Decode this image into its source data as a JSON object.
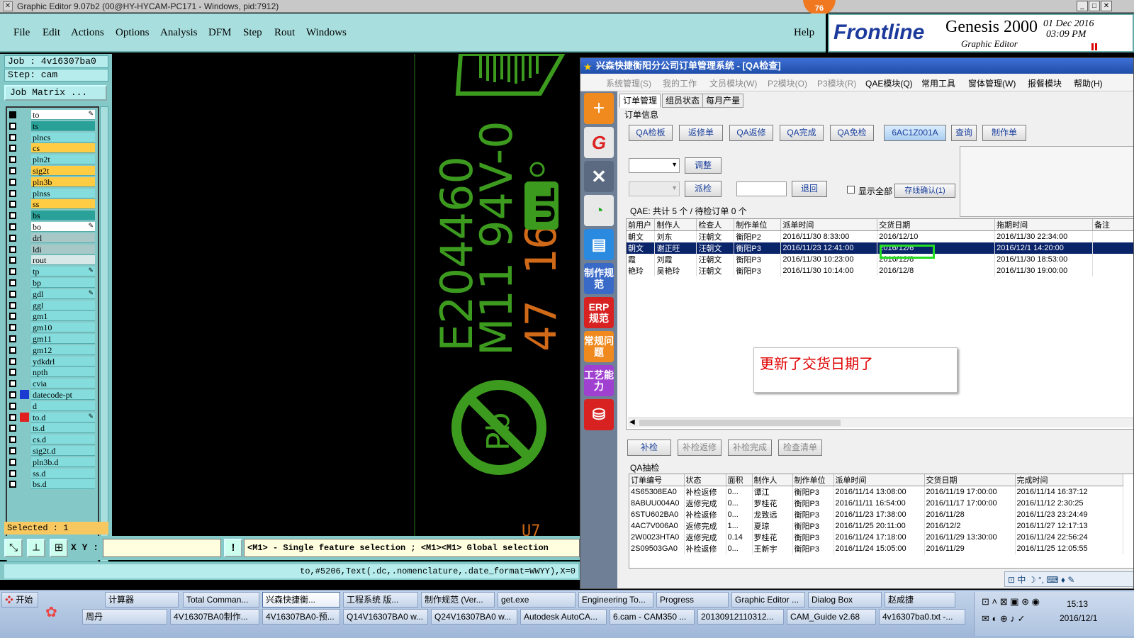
{
  "titlebar": {
    "text": "Graphic Editor 9.07b2 (00@HY-HYCAM-PC171 - Windows, pid:7912)",
    "badge": "76"
  },
  "menu": [
    "File",
    "Edit",
    "Actions",
    "Options",
    "Analysis",
    "DFM",
    "Step",
    "Rout",
    "Windows"
  ],
  "help": "Help",
  "brand": {
    "logo": "Frontline",
    "product": "Genesis 2000",
    "subtitle": "Graphic Editor",
    "date": "01 Dec 2016",
    "time": "03:09 PM"
  },
  "job": {
    "job": "Job : 4v16307ba0",
    "step": "Step: cam",
    "matrix": "Job Matrix ...",
    "selected": "Selected : 1"
  },
  "layers": [
    {
      "name": "to",
      "color": "#ffffff",
      "mark": "✎"
    },
    {
      "name": "ts",
      "color": "#2aa198"
    },
    {
      "name": "plncs",
      "color": "#84dcdc"
    },
    {
      "name": "cs",
      "color": "#ffcc44"
    },
    {
      "name": "pln2t",
      "color": "#84dcdc"
    },
    {
      "name": "sig2t",
      "color": "#ffcc44"
    },
    {
      "name": "pln3b",
      "color": "#ffcc44"
    },
    {
      "name": "plnss",
      "color": "#84dcdc"
    },
    {
      "name": "ss",
      "color": "#ffcc44"
    },
    {
      "name": "bs",
      "color": "#2aa198"
    },
    {
      "name": "bo",
      "color": "#ffffff",
      "mark": "✎"
    },
    {
      "name": "drl",
      "color": "#a8c8c8"
    },
    {
      "name": "ldi",
      "color": "#a8c8c8"
    },
    {
      "name": "rout",
      "color": "#d8e8e8"
    },
    {
      "name": "tp",
      "color": "#84dcdc",
      "mark": "✎"
    },
    {
      "name": "bp",
      "color": "#84dcdc"
    },
    {
      "name": "gdl",
      "color": "#84dcdc",
      "mark": "✎"
    },
    {
      "name": "ggl",
      "color": "#84dcdc"
    },
    {
      "name": "gm1",
      "color": "#84dcdc"
    },
    {
      "name": "gm10",
      "color": "#84dcdc"
    },
    {
      "name": "gm11",
      "color": "#84dcdc"
    },
    {
      "name": "gm12",
      "color": "#84dcdc"
    },
    {
      "name": "ydkdrl",
      "color": "#84dcdc"
    },
    {
      "name": "npth",
      "color": "#84dcdc"
    },
    {
      "name": "cvia",
      "color": "#84dcdc"
    },
    {
      "name": "datecode-pt",
      "color": "#84dcdc"
    },
    {
      "name": "d",
      "color": "#84dcdc"
    },
    {
      "name": "to.d",
      "color": "#84dcdc",
      "mark": "✎"
    },
    {
      "name": "ts.d",
      "color": "#84dcdc"
    },
    {
      "name": "cs.d",
      "color": "#84dcdc"
    },
    {
      "name": "sig2t.d",
      "color": "#84dcdc"
    },
    {
      "name": "pln3b.d",
      "color": "#84dcdc"
    },
    {
      "name": "ss.d",
      "color": "#84dcdc"
    },
    {
      "name": "bs.d",
      "color": "#84dcdc"
    }
  ],
  "canvas": {
    "line1": "E204460",
    "line2": "M11 94V-0",
    "orange": "47 16",
    "pb": "Pb"
  },
  "cam": {
    "xy_label": "X Y :",
    "hint": "<M1> - Single feature selection ; <M1><M1> Global selection",
    "status": "to,#5206,Text(.dc,.nomenclature,.date_format=WWYY),X=0"
  },
  "qa": {
    "title": "兴森快捷衡阳分公司订单管理系统 - [QA检查]",
    "menu": [
      {
        "label": "系统管理(S)",
        "dis": true
      },
      {
        "label": "我的工作",
        "dis": true
      },
      {
        "label": "文员模块(W)",
        "dis": true
      },
      {
        "label": "P2模块(O)",
        "dis": true
      },
      {
        "label": "P3模块(R)",
        "dis": true
      },
      {
        "label": "QAE模块(Q)",
        "dis": false
      },
      {
        "label": "常用工具",
        "dis": false
      },
      {
        "label": "窗体管理(W)",
        "dis": false
      },
      {
        "label": "报餐模块",
        "dis": false
      },
      {
        "label": "帮助(H)",
        "dis": false
      }
    ],
    "sidebar": [
      "制作规范",
      "ERP规范",
      "常规问题",
      "工艺能力"
    ],
    "tabs": [
      "订单管理",
      "组员状态",
      "每月产量"
    ],
    "group1": "订单信息",
    "buttons": [
      "QA检板",
      "返修单",
      "QA返修",
      "QA完成",
      "QA免检",
      "6AC1Z001A",
      "查询",
      "制作单"
    ],
    "adjust": "调整",
    "dispatch": "派检",
    "back": "退回",
    "show_all": "显示全部",
    "confirm": "存线确认(1)",
    "summary": "QAE: 共计 5 个 / 待检订单 0 个",
    "table1_headers": [
      "前用户",
      "制作人",
      "检查人",
      "制作单位",
      "派单时间",
      "交货日期",
      "拖期时间",
      "备注"
    ],
    "table1_rows": [
      [
        "朝文",
        "刘东",
        "汪朝文",
        "衡阳P2",
        "2016/11/30 8:33:00",
        "2016/12/10",
        "2016/11/30 22:34:00",
        ""
      ],
      [
        "朝文",
        "谢正旺",
        "汪朝文",
        "衡阳P3",
        "2016/11/23 12:41:00",
        "2016/12/6",
        "2016/12/1 14:20:00",
        ""
      ],
      [
        "霞",
        "刘霞",
        "汪朝文",
        "衡阳P3",
        "2016/11/30 10:23:00",
        "2016/12/8",
        "2016/11/30 18:53:00",
        ""
      ],
      [
        "艳玲",
        "吴艳玲",
        "汪朝文",
        "衡阳P3",
        "2016/11/30 10:14:00",
        "2016/12/8",
        "2016/11/30 19:00:00",
        ""
      ]
    ],
    "notice": "更新了交货日期了",
    "buttons2": [
      "补检",
      "补检返修",
      "补检完成",
      "检查清单"
    ],
    "group2": "QA抽检",
    "table2_headers": [
      "订单编号",
      "状态",
      "面积",
      "制作人",
      "制作单位",
      "派单时间",
      "交货日期",
      "完成时间"
    ],
    "table2_rows": [
      [
        "4S65308EA0",
        "补检返修",
        "0...",
        "谭江",
        "衡阳P3",
        "2016/11/14 13:08:00",
        "2016/11/19 17:00:00",
        "2016/11/14 16:37:12"
      ],
      [
        "8ABUU004A0",
        "返修完成",
        "0...",
        "罗桂花",
        "衡阳P3",
        "2016/11/11 16:54:00",
        "2016/11/17 17:00:00",
        "2016/11/12 2:30:25"
      ],
      [
        "6STU602BA0",
        "补检返修",
        "0...",
        "龙致远",
        "衡阳P3",
        "2016/11/23 17:38:00",
        "2016/11/28",
        "2016/11/23 23:24:49"
      ],
      [
        "4AC7V006A0",
        "返修完成",
        "1...",
        "夏琼",
        "衡阳P3",
        "2016/11/25 20:11:00",
        "2016/12/2",
        "2016/11/27 12:17:13"
      ],
      [
        "2W0023HTA0",
        "返修完成",
        "0.14",
        "罗桂花",
        "衡阳P3",
        "2016/11/24 17:18:00",
        "2016/11/29 13:30:00",
        "2016/11/24 22:56:24"
      ],
      [
        "2S09503GA0",
        "补检返修",
        "0...",
        "王新宇",
        "衡阳P3",
        "2016/11/24 15:05:00",
        "2016/11/29",
        "2016/11/25 12:05:55"
      ]
    ]
  },
  "taskbar": {
    "start": "开始",
    "row1": [
      "计算器",
      "Total Comman...",
      "兴森快捷衡...",
      "工程系统  版...",
      "制作规范 (Ver...",
      "get.exe",
      "Engineering To...",
      "Progress",
      "Graphic Editor ...",
      "Dialog Box",
      "赵成捷"
    ],
    "row2": [
      "周丹",
      "4V16307BA0制作...",
      "4V16307BA0-预...",
      "Q14V16307BA0 w...",
      "Q24V16307BA0 w...",
      "Autodesk AutoCA...",
      "6.cam - CAM350 ...",
      "20130912110312...",
      "CAM_Guide v2.68",
      "4v16307ba0.txt -..."
    ],
    "clock_time": "15:13",
    "clock_date": "2016/12/1"
  },
  "colors": {
    "silk_green": "#3c9a1e",
    "silk_orange": "#d06a18",
    "cam_teal": "#84c8c8",
    "highlight": "#0a246a"
  }
}
